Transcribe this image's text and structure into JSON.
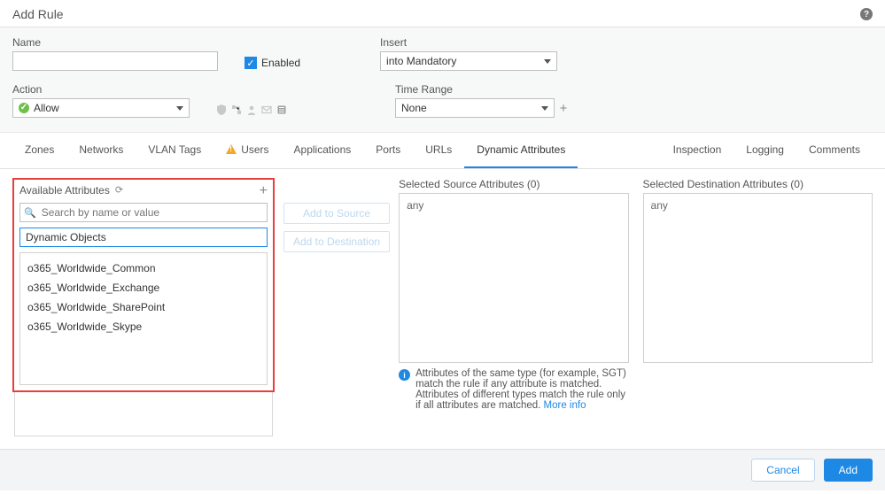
{
  "dialog": {
    "title": "Add Rule"
  },
  "form": {
    "name": {
      "label": "Name",
      "value": ""
    },
    "enabled": {
      "label": "Enabled",
      "checked": true
    },
    "insert": {
      "label": "Insert",
      "value": "into Mandatory"
    },
    "action": {
      "label": "Action",
      "value": "Allow"
    },
    "time_range": {
      "label": "Time Range",
      "value": "None"
    }
  },
  "tabs": {
    "left": [
      "Zones",
      "Networks",
      "VLAN Tags",
      "Users",
      "Applications",
      "Ports",
      "URLs",
      "Dynamic Attributes"
    ],
    "right": [
      "Inspection",
      "Logging",
      "Comments"
    ],
    "active": "Dynamic Attributes",
    "warning_tab": "Users"
  },
  "available": {
    "title": "Available Attributes",
    "search_placeholder": "Search by name or value",
    "type_selected": "Dynamic Objects",
    "items": [
      "o365_Worldwide_Common",
      "o365_Worldwide_Exchange",
      "o365_Worldwide_SharePoint",
      "o365_Worldwide_Skype"
    ]
  },
  "action_buttons": {
    "add_source": "Add to Source",
    "add_destination": "Add to Destination"
  },
  "selected_source": {
    "label": "Selected Source Attributes (0)",
    "value": "any"
  },
  "selected_destination": {
    "label": "Selected Destination Attributes (0)",
    "value": "any"
  },
  "info": {
    "line1": "Attributes of the same type (for example, SGT) match the rule if any attribute is matched.",
    "line2": "Attributes of different types match the rule only if all attributes are matched. ",
    "link": "More info"
  },
  "footer": {
    "cancel": "Cancel",
    "add": "Add"
  }
}
